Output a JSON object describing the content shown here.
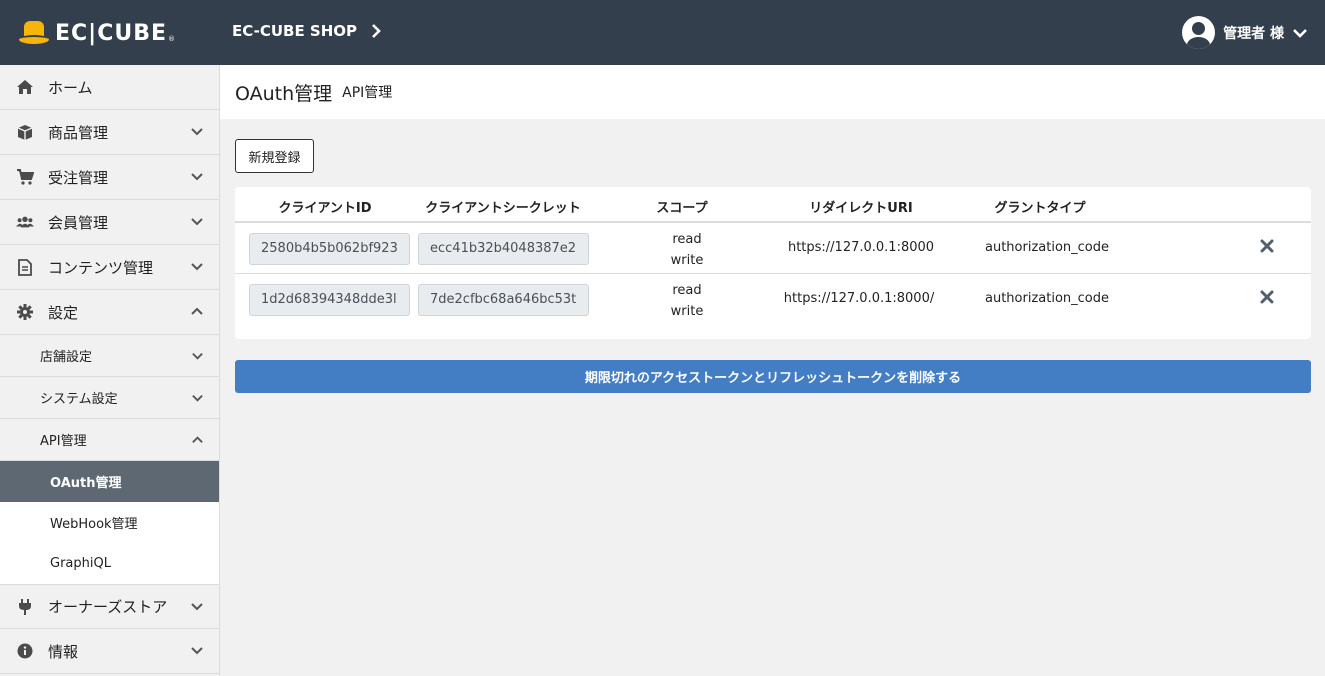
{
  "header": {
    "logo_text": "EC|CUBE",
    "logo_reg": "®",
    "shop_name": "EC-CUBE SHOP",
    "user_label": "管理者 様"
  },
  "sidebar": {
    "items": [
      {
        "label": "ホーム",
        "icon": "home-icon"
      },
      {
        "label": "商品管理",
        "icon": "box-icon"
      },
      {
        "label": "受注管理",
        "icon": "cart-icon"
      },
      {
        "label": "会員管理",
        "icon": "users-icon"
      },
      {
        "label": "コンテンツ管理",
        "icon": "file-icon"
      },
      {
        "label": "設定",
        "icon": "gear-icon"
      }
    ],
    "settings_sub": [
      {
        "label": "店舗設定"
      },
      {
        "label": "システム設定"
      },
      {
        "label": "API管理"
      }
    ],
    "api_sub": [
      {
        "label": "OAuth管理",
        "active": true
      },
      {
        "label": "WebHook管理"
      },
      {
        "label": "GraphiQL"
      }
    ],
    "bottom_items": [
      {
        "label": "オーナーズストア",
        "icon": "plug-icon"
      },
      {
        "label": "情報",
        "icon": "info-icon"
      }
    ]
  },
  "page": {
    "title": "OAuth管理",
    "subtitle": "API管理",
    "new_button": "新規登録",
    "purge_button": "期限切れのアクセストークンとリフレッシュトークンを削除する"
  },
  "table": {
    "headers": [
      "クライアントID",
      "クライアントシークレット",
      "スコープ",
      "リダイレクトURI",
      "グラントタイプ"
    ],
    "rows": [
      {
        "client_id": "2580b4b5b062bf923",
        "client_secret": "ecc41b32b4048387e2",
        "scope_read": "read",
        "scope_write": "write",
        "redirect_uri": "https://127.0.0.1:8000",
        "grant_type": "authorization_code"
      },
      {
        "client_id": "1d2d68394348dde3l",
        "client_secret": "7de2cfbc68a646bc53t",
        "scope_read": "read",
        "scope_write": "write",
        "redirect_uri": "https://127.0.0.1:8000/",
        "grant_type": "authorization_code"
      }
    ]
  },
  "colors": {
    "header_bg": "#333f4d",
    "logo_accent": "#f5b50a",
    "primary": "#437ec4",
    "active_nav": "#5d6873"
  }
}
